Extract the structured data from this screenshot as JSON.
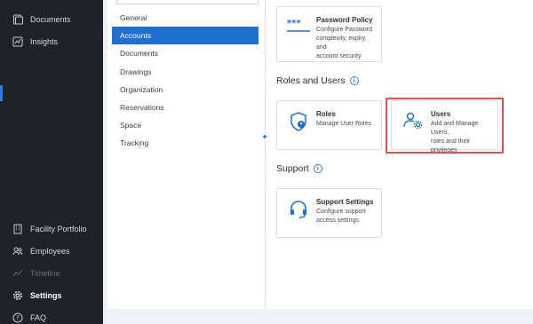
{
  "sidebar": {
    "items": [
      {
        "name": "nav-documents",
        "icon": "documents-icon",
        "label": "Documents"
      },
      {
        "name": "nav-insights",
        "icon": "insights-icon",
        "label": "Insights"
      },
      {
        "name": "nav-facility-portfolio",
        "icon": "facility-icon",
        "label": "Facility Portfolio"
      },
      {
        "name": "nav-employees",
        "icon": "employees-icon",
        "label": "Employees"
      },
      {
        "name": "nav-timeline",
        "icon": "timeline-icon",
        "label": "Timeline"
      },
      {
        "name": "nav-settings",
        "icon": "settings-icon",
        "label": "Settings"
      },
      {
        "name": "nav-faq",
        "icon": "faq-icon",
        "label": "FAQ"
      }
    ]
  },
  "submenu": {
    "items": [
      "General",
      "Accounts",
      "Documents",
      "Drawings",
      "Organization",
      "Reservations",
      "Space",
      "Tracking"
    ],
    "active": "Accounts"
  },
  "password_card": {
    "title": "Password Policy",
    "desc_line1": "Configure Password",
    "desc_line2": "complexity, expiry, and",
    "desc_line3": "account security"
  },
  "roles_section": {
    "title": "Roles and Users"
  },
  "roles_card": {
    "title": "Roles",
    "desc_line1": "Manage User Roles"
  },
  "users_card": {
    "title": "Users",
    "desc_line1": "Add and Manage Users,",
    "desc_line2": "roles and their privileges"
  },
  "support_section": {
    "title": "Support"
  },
  "support_card": {
    "title": "Support Settings",
    "desc_line1": "Configure support",
    "desc_line2": "access settings"
  },
  "colors": {
    "accent": "#1f6fd1",
    "sidebar_bg": "#1f2226",
    "highlight": "#d9534f"
  }
}
